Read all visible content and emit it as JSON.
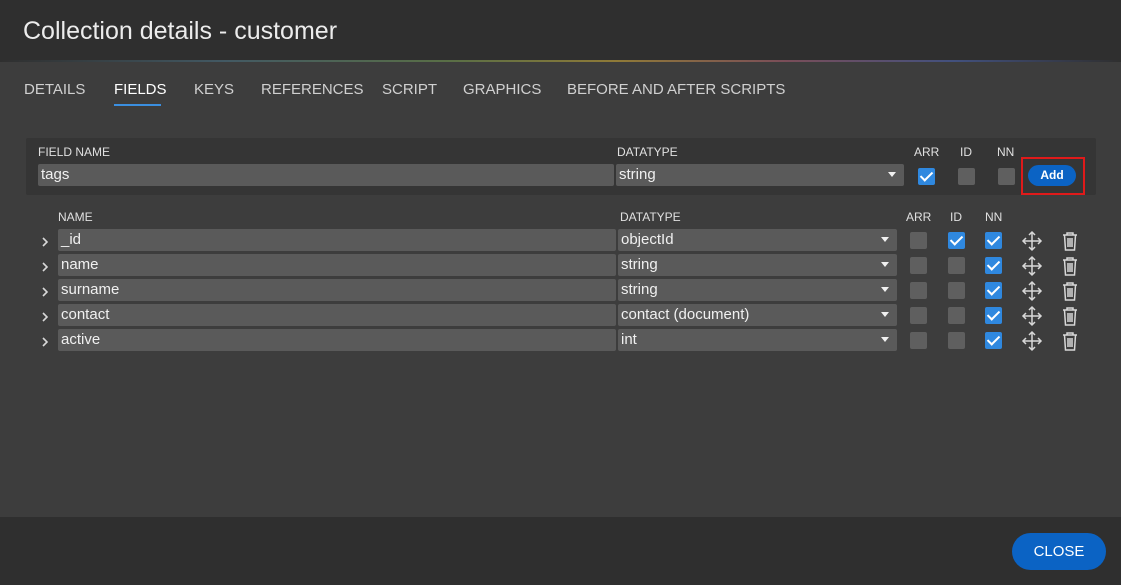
{
  "dialog": {
    "title": "Collection details - customer"
  },
  "tabs": [
    {
      "label": "DETAILS"
    },
    {
      "label": "FIELDS",
      "active": true
    },
    {
      "label": "KEYS"
    },
    {
      "label": "REFERENCES"
    },
    {
      "label": "SCRIPT"
    },
    {
      "label": "GRAPHICS"
    },
    {
      "label": "BEFORE AND AFTER SCRIPTS"
    }
  ],
  "new_field": {
    "field_name_label": "FIELD NAME",
    "datatype_label": "DATATYPE",
    "arr_label": "ARR",
    "id_label": "ID",
    "nn_label": "NN",
    "name_value": "tags",
    "datatype_value": "string",
    "arr": true,
    "id": false,
    "nn": false,
    "add_label": "Add"
  },
  "fields_table": {
    "headers": {
      "name": "NAME",
      "datatype": "DATATYPE",
      "arr": "ARR",
      "id": "ID",
      "nn": "NN"
    },
    "rows": [
      {
        "name": "_id",
        "datatype": "objectId",
        "arr": false,
        "id": true,
        "nn": true
      },
      {
        "name": "name",
        "datatype": "string",
        "arr": false,
        "id": false,
        "nn": true
      },
      {
        "name": "surname",
        "datatype": "string",
        "arr": false,
        "id": false,
        "nn": true
      },
      {
        "name": "contact",
        "datatype": "contact (document)",
        "arr": false,
        "id": false,
        "nn": true
      },
      {
        "name": "active",
        "datatype": "int",
        "arr": false,
        "id": false,
        "nn": true
      }
    ]
  },
  "footer": {
    "close_label": "CLOSE"
  },
  "colors": {
    "accent": "#0b63c4",
    "checkbox_checked": "#2f88df",
    "highlight": "#e01a1a"
  }
}
